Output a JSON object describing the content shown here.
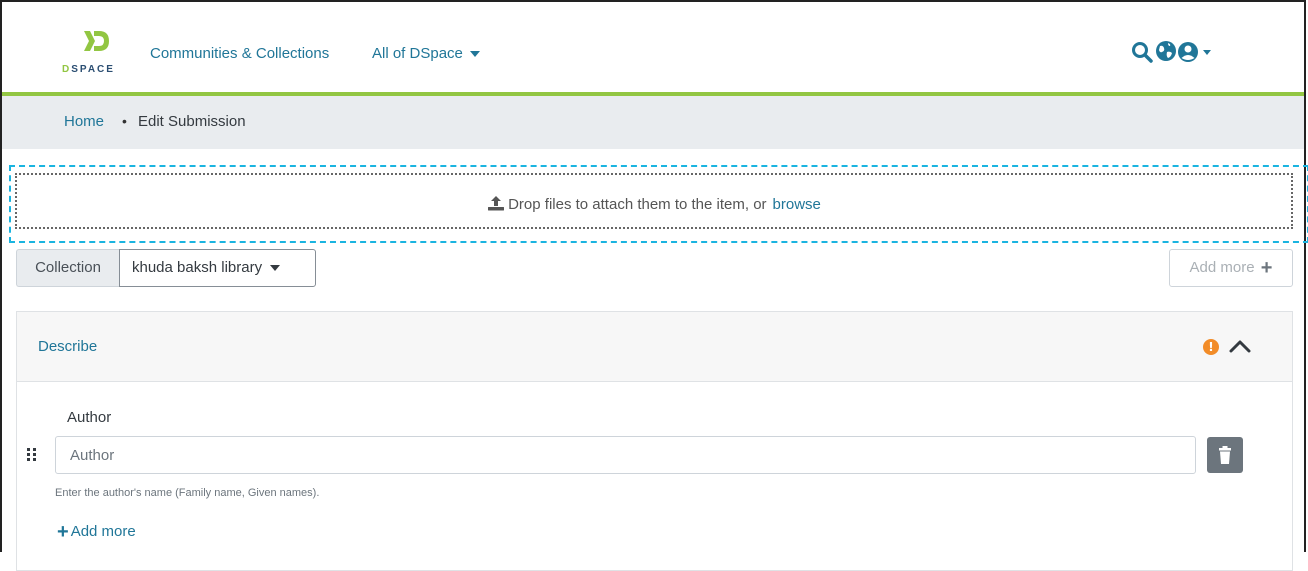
{
  "header": {
    "logo_text": "DSPACE",
    "nav": {
      "communities": "Communities & Collections",
      "all_of_dspace": "All of DSpace"
    },
    "icons": [
      "search-icon",
      "globe-icon",
      "user-icon"
    ]
  },
  "breadcrumb": {
    "home": "Home",
    "separator": "•",
    "current": "Edit Submission"
  },
  "upload": {
    "text": "Drop files to attach them to the item, or",
    "browse": "browse"
  },
  "collection": {
    "label": "Collection",
    "value": "khuda baksh library",
    "add_more": "Add more"
  },
  "section": {
    "title": "Describe",
    "status_icon": "warning-icon",
    "status_color": "#f28c28"
  },
  "author_field": {
    "label": "Author",
    "placeholder": "Author",
    "value": "",
    "hint": "Enter the author's name (Family name, Given names).",
    "add_more": "Add more"
  },
  "colors": {
    "accent_green": "#92c642",
    "link_blue": "#207698",
    "drop_border": "#1ab4e0"
  }
}
